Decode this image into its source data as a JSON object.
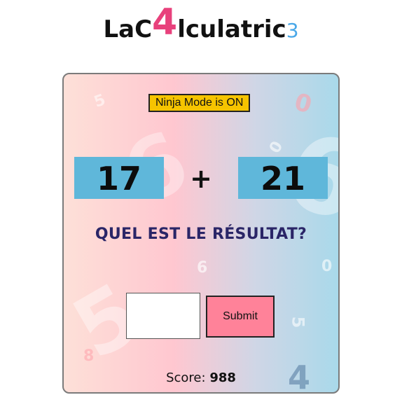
{
  "title": {
    "part1": "LaC",
    "big_digit": "4",
    "part2": "lculatric",
    "small_digit": "3"
  },
  "colors": {
    "title_accent": "#e8417c",
    "title_small_digit": "#4aa8e8",
    "number_box": "#5fb7da",
    "ninja_badge": "#f6c400",
    "submit_button": "#ff8299",
    "question_text": "#2a2567"
  },
  "game": {
    "ninja_mode": "Ninja Mode is ON",
    "operand1": "17",
    "operator": "+",
    "operand2": "21",
    "question": "QUEL EST LE RÉSULTAT?",
    "answer_value": "",
    "submit_label": "Submit",
    "score_label": "Score:",
    "score_value": "988"
  },
  "background_digits": [
    "5",
    "0",
    "6",
    "0",
    "6",
    "0",
    "6",
    "8",
    "5",
    "4",
    "5"
  ]
}
